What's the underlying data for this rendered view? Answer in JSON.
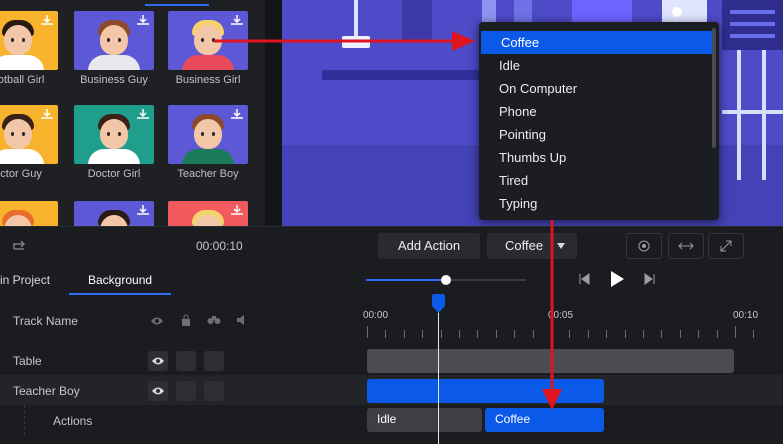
{
  "library": {
    "characters": [
      {
        "name": "ootball Girl",
        "bg": "#f7b32b"
      },
      {
        "name": "Business Guy",
        "bg": "#5d58d6"
      },
      {
        "name": "Business Girl",
        "bg": "#5d58d6"
      },
      {
        "name": "octor Guy",
        "bg": "#f7b32b"
      },
      {
        "name": "Doctor Girl",
        "bg": "#e4584b"
      },
      {
        "name": "Teacher Boy",
        "bg": "#5d58d6"
      },
      {
        "name": "",
        "bg": "#f7b32b"
      },
      {
        "name": "",
        "bg": "#5d58d6"
      },
      {
        "name": "",
        "bg": "#f25a5f"
      }
    ]
  },
  "dropdown": {
    "items": [
      "Coffee",
      "Idle",
      "On Computer",
      "Phone",
      "Pointing",
      "Thumbs Up",
      "Tired",
      "Typing"
    ],
    "selected": "Coffee"
  },
  "toolbar": {
    "time": "00:00:10",
    "add_action": "Add Action",
    "action_select": "Coffee"
  },
  "tabs": {
    "in_project": "in Project",
    "background": "Background"
  },
  "timeline": {
    "track_name_header": "Track Name",
    "ruler": [
      "00:00",
      "00:05",
      "00:10"
    ],
    "rows": {
      "table": "Table",
      "teacher_boy": "Teacher Boy",
      "actions": "Actions"
    },
    "clips": {
      "idle": "Idle",
      "coffee": "Coffee"
    }
  },
  "colors": {
    "accent": "#0a59e8",
    "annotation_arrow": "#e0141e",
    "preview_bg": "#4d4bc8"
  }
}
